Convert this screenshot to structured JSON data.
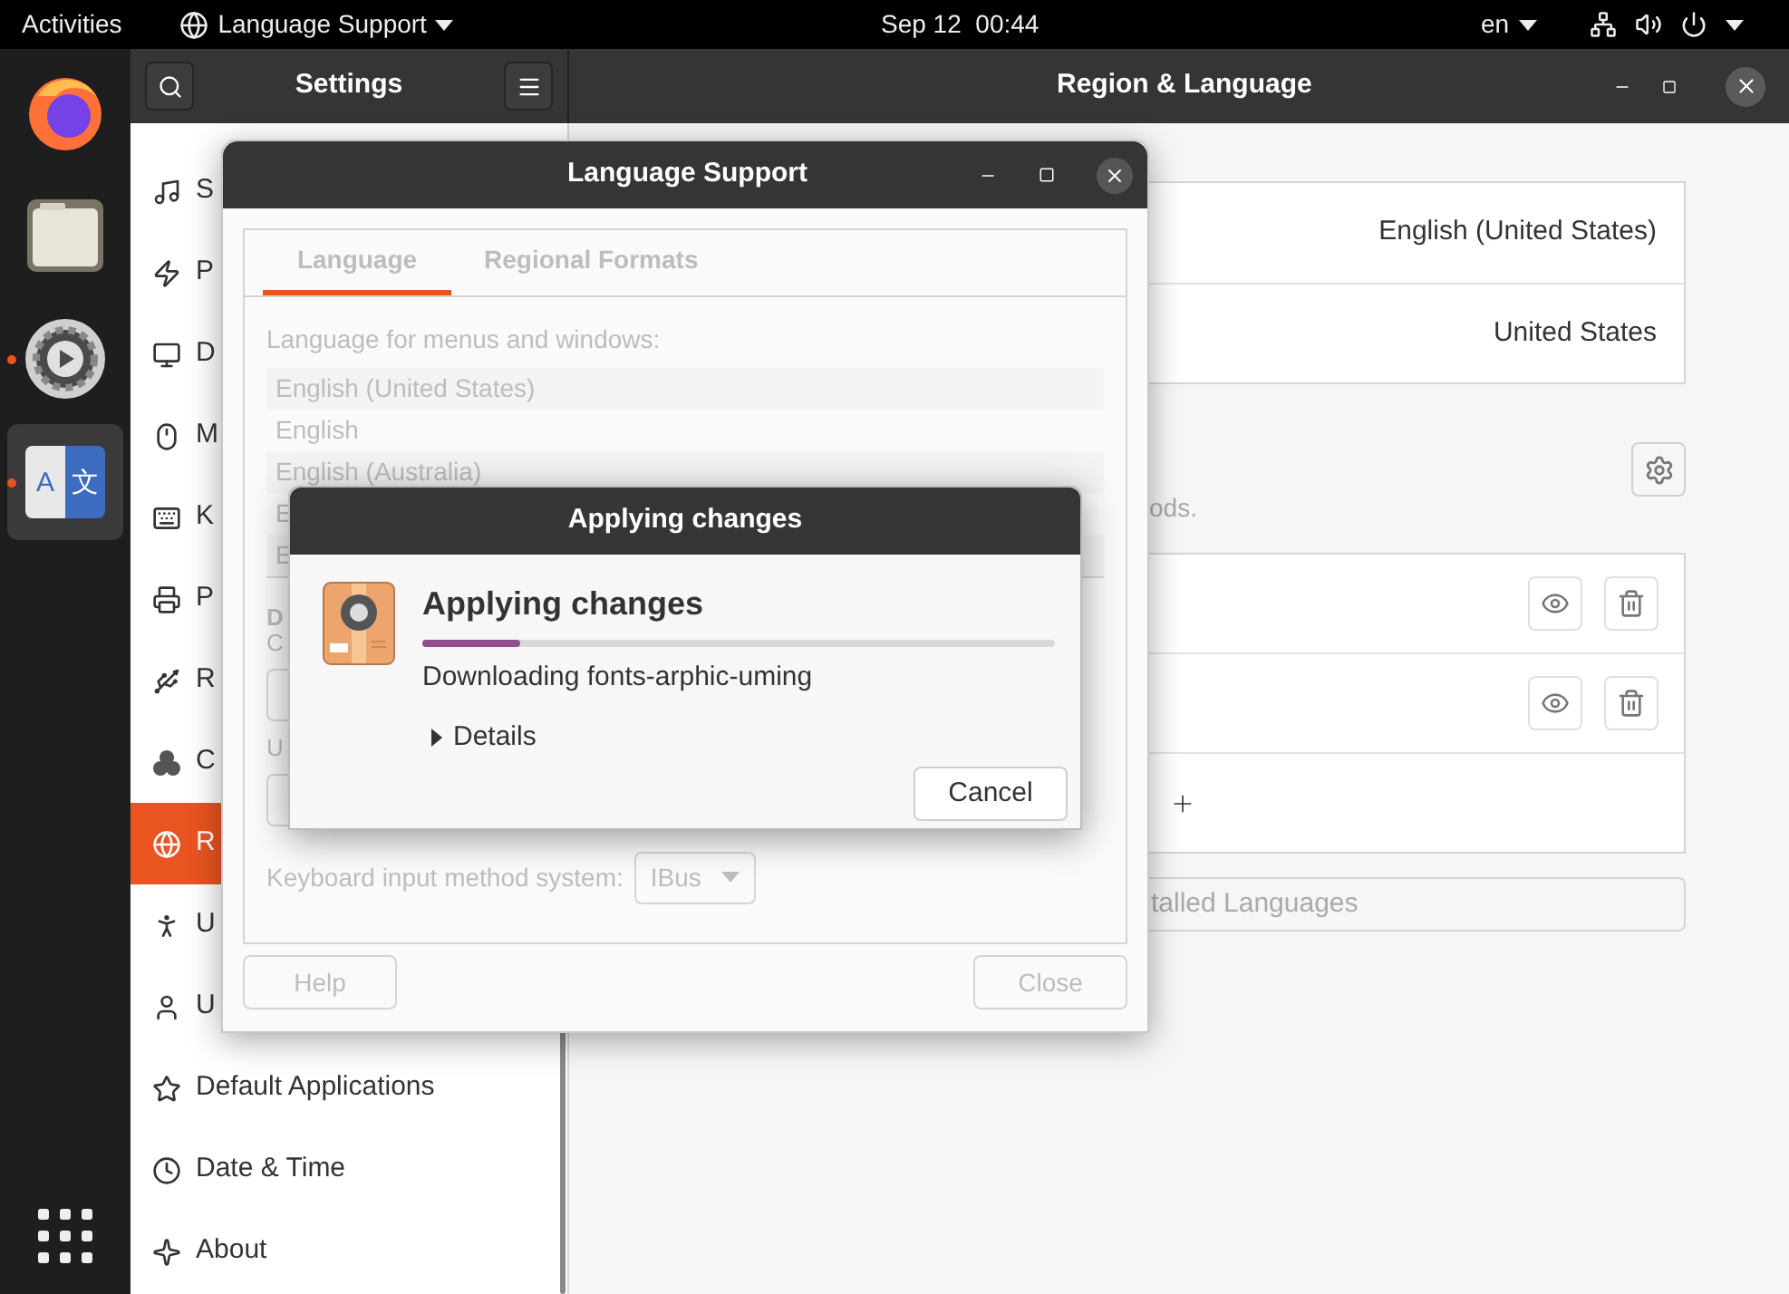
{
  "top_bar": {
    "activities": "Activities",
    "app_menu": "Language Support",
    "clock": "Sep 12  00:44",
    "input_source": "en"
  },
  "dock": [
    {
      "running": false,
      "selected": false
    },
    {
      "running": false,
      "selected": false
    },
    {
      "running": true,
      "selected": false
    },
    {
      "running": true,
      "selected": true,
      "glyphs": [
        "A",
        "文"
      ]
    }
  ],
  "settings": {
    "sidebar_title": "Settings",
    "page_title": "Region & Language",
    "sidebar": [
      {
        "label": "S",
        "selected": false
      },
      {
        "label": "P",
        "selected": false
      },
      {
        "label": "D",
        "selected": false
      },
      {
        "label": "M",
        "selected": false
      },
      {
        "label": "K",
        "selected": false
      },
      {
        "label": "P",
        "selected": false
      },
      {
        "label": "R",
        "selected": false
      },
      {
        "label": "C",
        "selected": false
      },
      {
        "label": "R",
        "selected": true
      },
      {
        "label": "U",
        "selected": false
      },
      {
        "label": "U",
        "selected": false
      },
      {
        "label": "Default Applications",
        "selected": false
      },
      {
        "label": "Date & Time",
        "selected": false
      },
      {
        "label": "About",
        "selected": false
      }
    ],
    "formats": [
      {
        "value": "English (United States)"
      },
      {
        "value": "United States"
      }
    ],
    "input_sources_hint": "ods.",
    "manage_button": "talled Languages"
  },
  "language_support": {
    "title": "Language Support",
    "disabled": true,
    "tabs": [
      {
        "label": "Language",
        "selected": true
      },
      {
        "label": "Regional Formats",
        "selected": false
      }
    ],
    "list_label": "Language for menus and windows:",
    "languages": [
      {
        "label": "English (United States)"
      },
      {
        "label": "English"
      },
      {
        "label": "English (Australia)"
      },
      {
        "label": "E"
      },
      {
        "label": "E"
      }
    ],
    "section_heading": "D",
    "section_hint": "C",
    "note": "U",
    "input_method_label": "Keyboard input method system:",
    "input_method_value": "IBus",
    "help_button": "Help",
    "close_button": "Close"
  },
  "applying": {
    "title": "Applying changes",
    "heading": "Applying changes",
    "level": 0.155,
    "status": "Downloading fonts-arphic-uming",
    "details": {
      "label": "Details",
      "expanded": false
    },
    "cancel_button": "Cancel"
  }
}
